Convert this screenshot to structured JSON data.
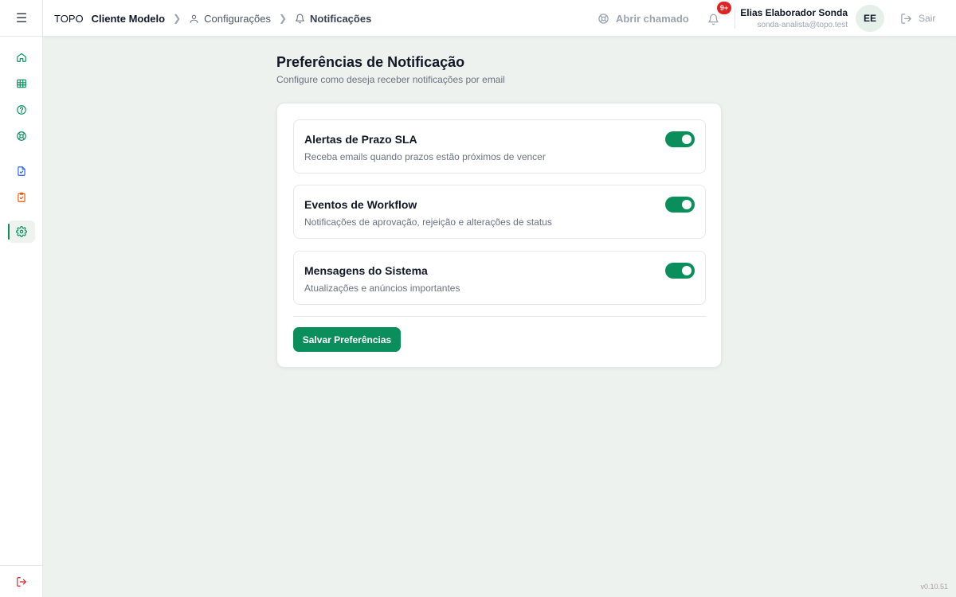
{
  "colors": {
    "accent": "#0a8f5c",
    "badge": "#dc2626",
    "muted": "#9ca3af"
  },
  "sidebar": {
    "items": [
      {
        "icon": "home-icon",
        "color": "#0a8f5c"
      },
      {
        "icon": "table-icon",
        "color": "#0a8f5c"
      },
      {
        "icon": "help-circle-icon",
        "color": "#0a8f5c"
      },
      {
        "icon": "lifebuoy-icon",
        "color": "#0a8f5c"
      },
      {
        "icon": "file-check-icon",
        "color": "#2563eb"
      },
      {
        "icon": "clipboard-check-icon",
        "color": "#ea580c"
      },
      {
        "icon": "gear-icon",
        "color": "#0a8f5c",
        "active": true
      }
    ],
    "logout_icon": "logout-icon"
  },
  "header": {
    "brand": "TOPO",
    "client": "Cliente Modelo",
    "breadcrumbs": [
      "Configurações",
      "Notificações"
    ],
    "support_label": "Abrir chamado",
    "notification_badge": "9+",
    "user_name": "Elias Elaborador Sonda",
    "user_email": "sonda-analista@topo.test",
    "avatar_initials": "EE",
    "logout_label": "Sair"
  },
  "main": {
    "title": "Preferências de Notificação",
    "subtitle": "Configure como deseja receber notificações por email",
    "preferences": [
      {
        "title": "Alertas de Prazo SLA",
        "description": "Receba emails quando prazos estão próximos de vencer",
        "enabled": true
      },
      {
        "title": "Eventos de Workflow",
        "description": "Notificações de aprovação, rejeição e alterações de status",
        "enabled": true
      },
      {
        "title": "Mensagens do Sistema",
        "description": "Atualizações e anúncios importantes",
        "enabled": true
      }
    ],
    "save_label": "Salvar Preferências"
  },
  "footer": {
    "version": "v0.10.51"
  }
}
